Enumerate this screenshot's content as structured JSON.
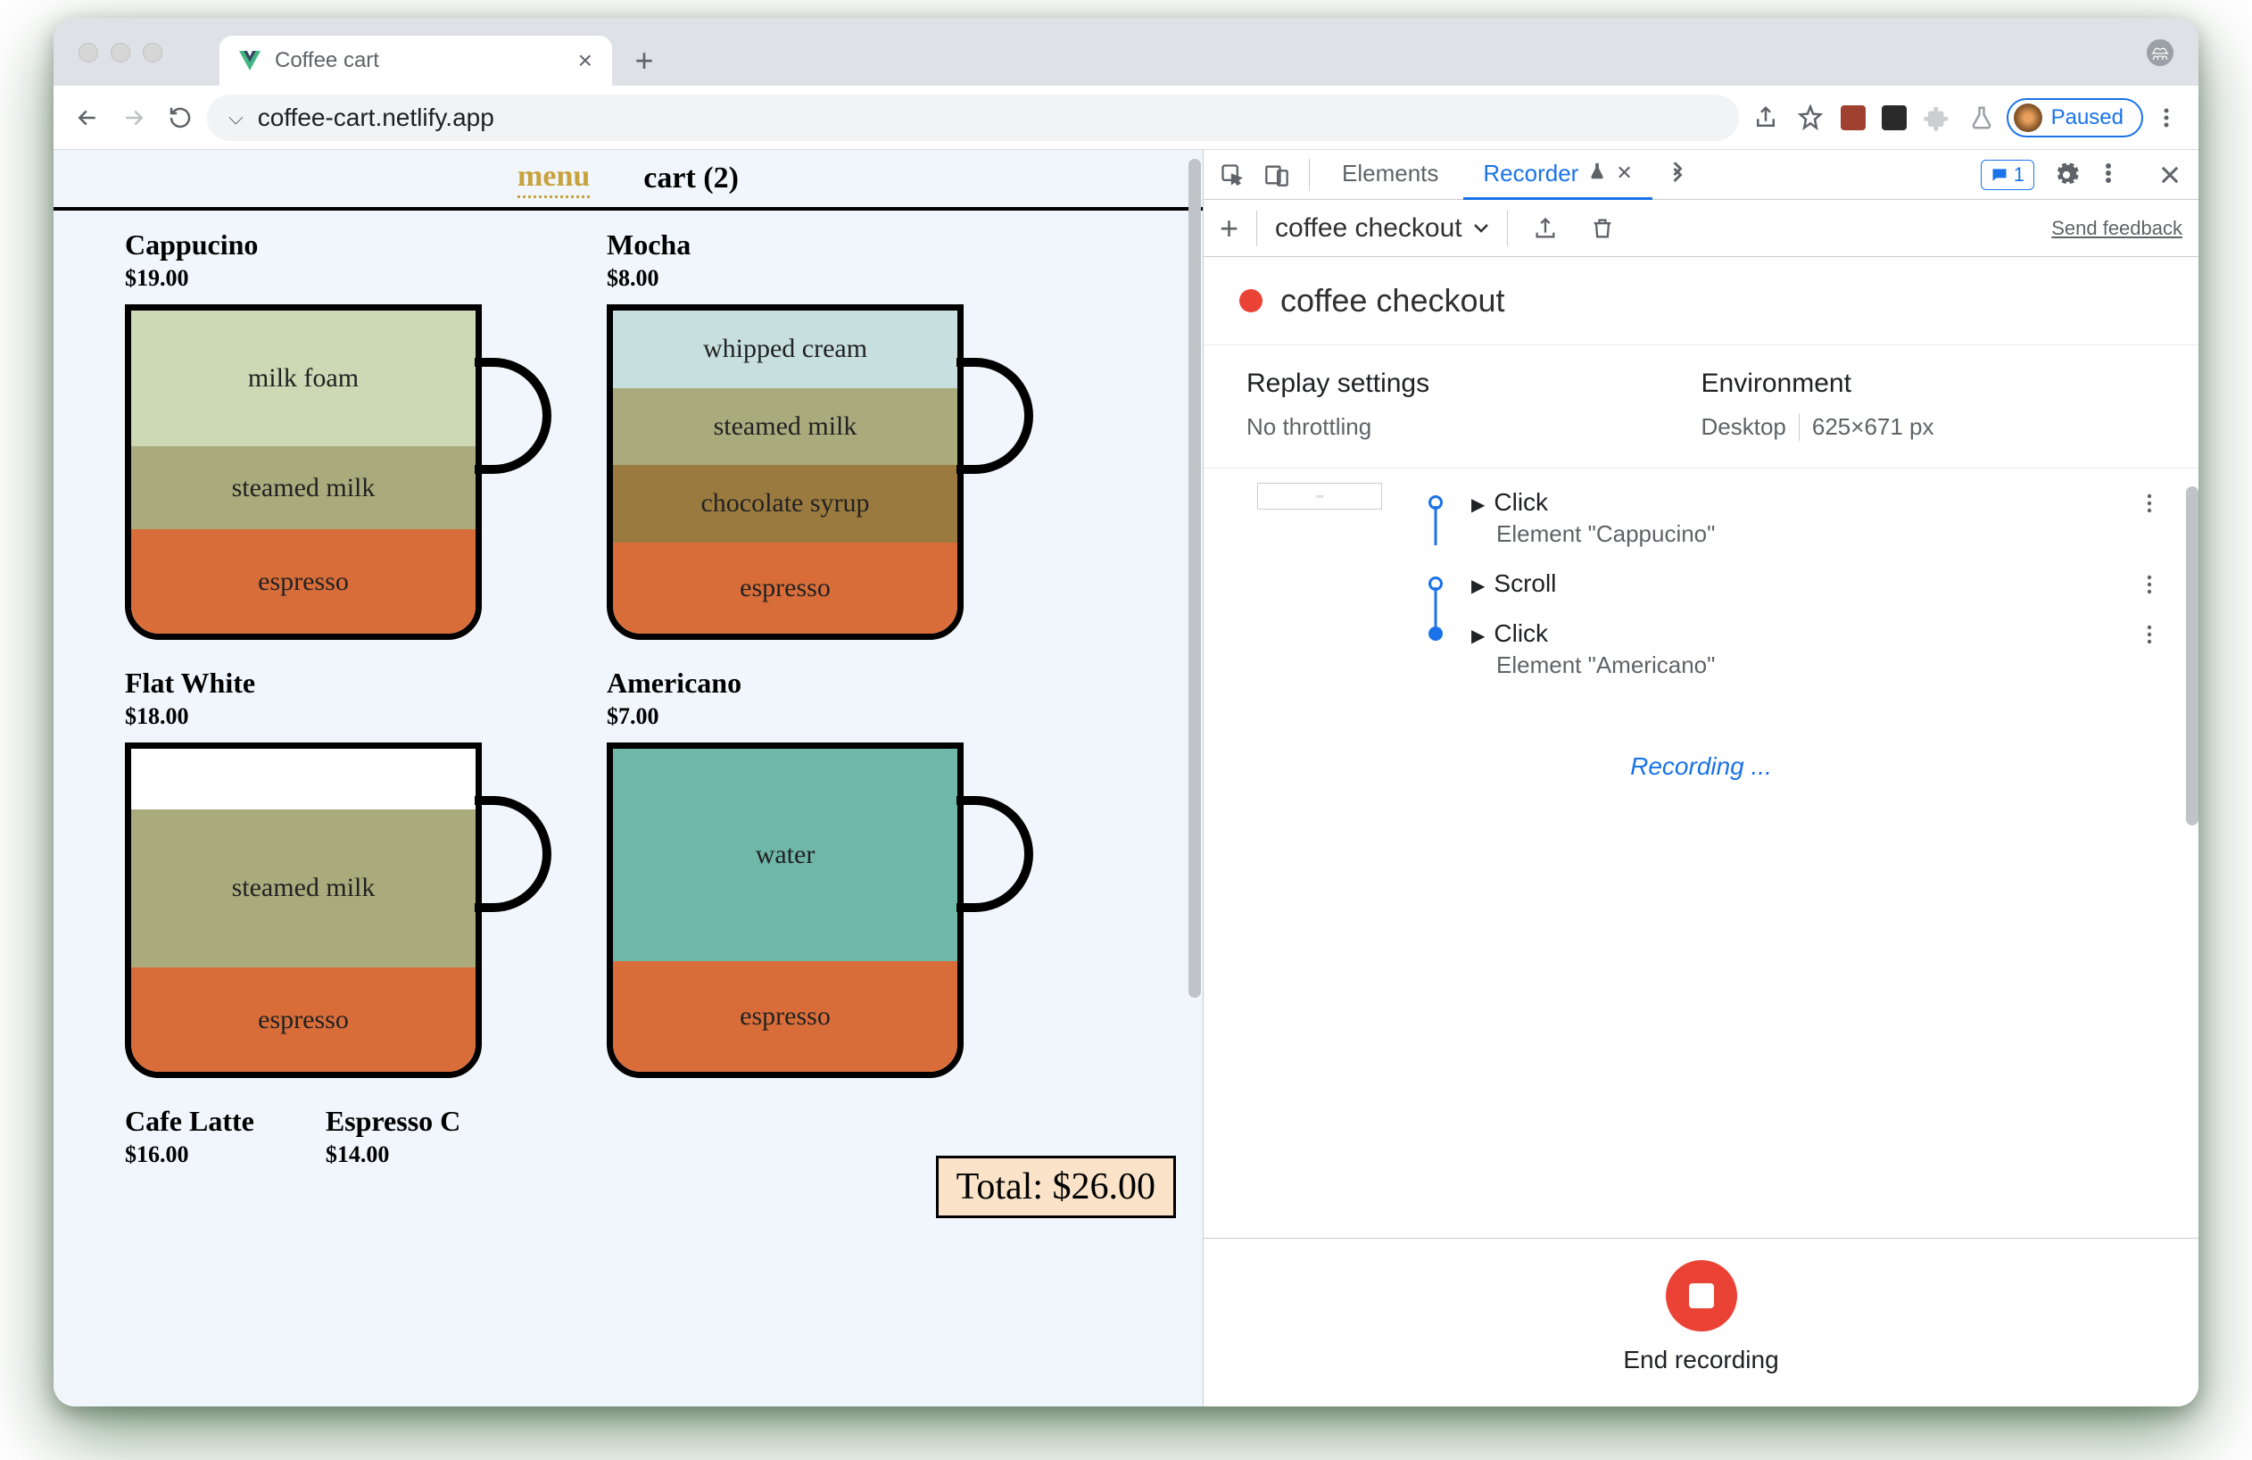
{
  "browser": {
    "tab_title": "Coffee cart",
    "url": "coffee-cart.netlify.app",
    "paused_label": "Paused"
  },
  "page": {
    "nav": {
      "menu": "menu",
      "cart": "cart (2)"
    },
    "products": [
      {
        "name": "Cappucino",
        "price": "$19.00",
        "layers": [
          {
            "label": "milk foam",
            "color": "#ccd9b4",
            "flex": 2
          },
          {
            "label": "steamed milk",
            "color": "#a9ab7d",
            "flex": 1
          },
          {
            "label": "espresso",
            "color": "#d96d3a",
            "flex": 1.4
          }
        ]
      },
      {
        "name": "Mocha",
        "price": "$8.00",
        "layers": [
          {
            "label": "whipped cream",
            "color": "#c7e0df",
            "flex": 1
          },
          {
            "label": "steamed milk",
            "color": "#a9ab7d",
            "flex": 1
          },
          {
            "label": "chocolate syrup",
            "color": "#9a7a3f",
            "flex": 1
          },
          {
            "label": "espresso",
            "color": "#d96d3a",
            "flex": 1.3
          }
        ]
      },
      {
        "name": "Flat White",
        "price": "$18.00",
        "layers": [
          {
            "label": "",
            "color": "#ffffff",
            "flex": 0.9
          },
          {
            "label": "steamed milk",
            "color": "#a9ab7d",
            "flex": 1.9
          },
          {
            "label": "espresso",
            "color": "#d96d3a",
            "flex": 1.1
          }
        ]
      },
      {
        "name": "Americano",
        "price": "$7.00",
        "layers": [
          {
            "label": "water",
            "color": "#6fb7a8",
            "flex": 2.7
          },
          {
            "label": "espresso",
            "color": "#d96d3a",
            "flex": 1.2
          }
        ]
      },
      {
        "name": "Cafe Latte",
        "price": "$16.00",
        "layers": []
      },
      {
        "name": "Espresso C",
        "price": "$14.00",
        "layers": []
      }
    ],
    "total": "Total: $26.00"
  },
  "devtools": {
    "tabs": {
      "elements": "Elements",
      "recorder": "Recorder"
    },
    "messages_count": "1",
    "feedback": "Send feedback",
    "recording_name": "coffee checkout",
    "title": "coffee checkout",
    "replay_settings_label": "Replay settings",
    "throttling": "No throttling",
    "environment_label": "Environment",
    "device": "Desktop",
    "viewport": "625×671 px",
    "steps": [
      {
        "name": "Click",
        "sub": "Element \"Cappucino\"",
        "bullet": "hollow",
        "thumb": true
      },
      {
        "name": "Scroll",
        "sub": "",
        "bullet": "hollow",
        "thumb": false
      },
      {
        "name": "Click",
        "sub": "Element \"Americano\"",
        "bullet": "solid",
        "thumb": false
      }
    ],
    "recording_status": "Recording ...",
    "end_recording": "End recording"
  }
}
